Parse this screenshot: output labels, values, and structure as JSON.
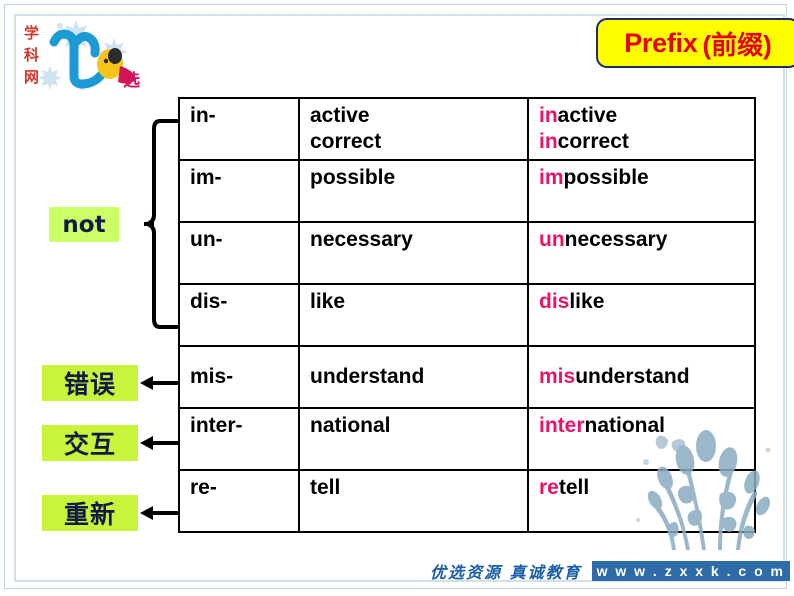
{
  "slide": {
    "title_en": "Prefix",
    "title_zh": "(前缀)",
    "logo_alt": "xuekewang-logo"
  },
  "table": {
    "rows": [
      {
        "prefix": "in-",
        "root": "active\ncorrect",
        "prefix_part": "in",
        "word_rest": "active\ncorrect",
        "valign": "top"
      },
      {
        "prefix": "im-",
        "root": "possible",
        "prefix_part": "im",
        "word_rest": "possible",
        "valign": "top"
      },
      {
        "prefix": "un-",
        "root": "necessary",
        "prefix_part": "un",
        "word_rest": "necessary",
        "valign": "top"
      },
      {
        "prefix": "dis-",
        "root": "like",
        "prefix_part": "dis",
        "word_rest": "like",
        "valign": "top"
      },
      {
        "prefix": "mis-",
        "root": "understand",
        "prefix_part": "mis",
        "word_rest": "understand",
        "valign": "middle"
      },
      {
        "prefix": "inter-",
        "root": "national",
        "prefix_part": "inter",
        "word_rest": "national",
        "valign": "top"
      },
      {
        "prefix": "re-",
        "root": "tell",
        "prefix_part": "re",
        "word_rest": "tell",
        "valign": "top"
      }
    ]
  },
  "labels": {
    "not": "not",
    "mis": "错误",
    "inter": "交互",
    "re": "重新"
  },
  "footer": {
    "slogan": "优选资源 真诚教育",
    "url": "w w w . z x x k . c o m"
  },
  "colors": {
    "prefix_pink": "#ec1268",
    "title_red": "#e8000b",
    "title_bg": "#ffff00",
    "title_border": "#1f2b6c",
    "chip_green": "#c8f53c",
    "chip_not_green": "#ccff66",
    "footer_blue": "#2d6ca8",
    "frame_blue": "#c3d4e2"
  }
}
